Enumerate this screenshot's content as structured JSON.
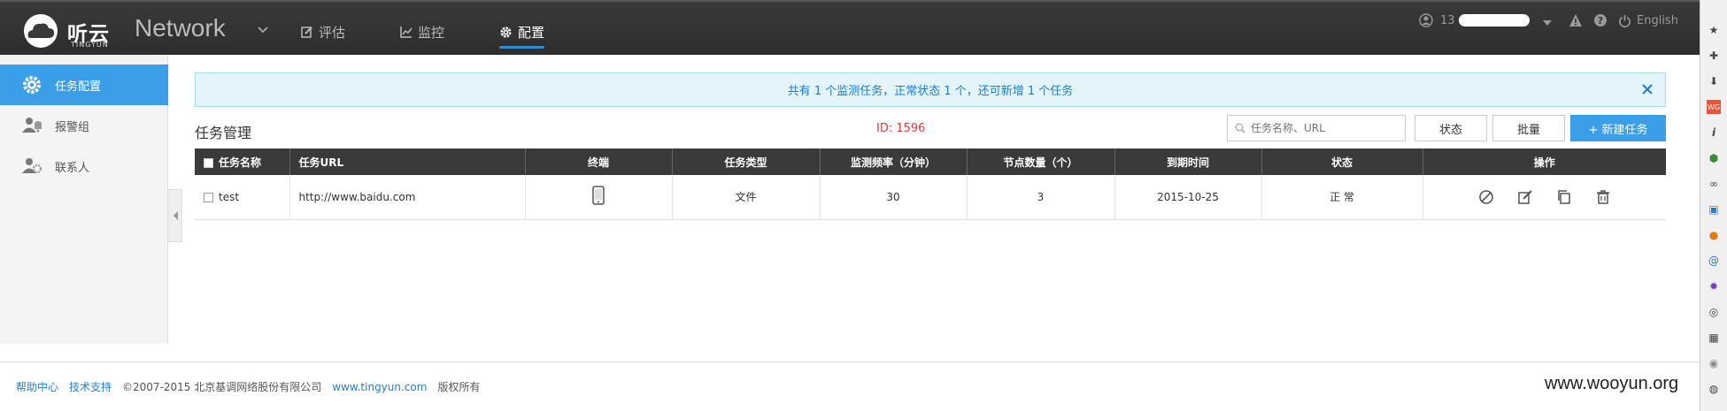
{
  "header": {
    "logo_cn": "听云",
    "logo_en": "TINGYUN",
    "product": "Network",
    "nav": [
      {
        "label": "评估",
        "icon": "edit-icon",
        "active": false
      },
      {
        "label": "监控",
        "icon": "chart-icon",
        "active": false
      },
      {
        "label": "配置",
        "icon": "gear-icon",
        "active": true
      }
    ],
    "user_prefix": "13",
    "language": "English"
  },
  "sidebar": {
    "items": [
      {
        "label": "任务配置",
        "icon": "gear-icon",
        "active": true
      },
      {
        "label": "报警组",
        "icon": "alarm-group-icon",
        "active": false
      },
      {
        "label": "联系人",
        "icon": "contacts-icon",
        "active": false
      }
    ]
  },
  "notice": {
    "text": "共有 1 个监测任务，正常状态 1 个，还可新增 1 个任务"
  },
  "section": {
    "title": "任务管理",
    "id_text": "ID: 1596",
    "search_placeholder": "任务名称、URL",
    "status_button": "状态",
    "batch_button": "批量",
    "new_button": "+ 新建任务"
  },
  "table": {
    "columns": [
      "任务名称",
      "任务URL",
      "终端",
      "任务类型",
      "监测频率（分钟）",
      "节点数量（个）",
      "到期时间",
      "状态",
      "操作"
    ],
    "rows": [
      {
        "name": "test",
        "url": "http://www.baidu.com",
        "terminal": "mobile-phone-icon",
        "type": "文件",
        "frequency": "30",
        "nodes": "3",
        "expire": "2015-10-25",
        "status": "正 常"
      }
    ]
  },
  "footer": {
    "help": "帮助中心",
    "support": "技术支持",
    "copyright": "©2007-2015  北京基调网络股份有限公司",
    "site": "www.tingyun.com",
    "rights": "版权所有"
  },
  "watermark": "www.wooyun.org"
}
